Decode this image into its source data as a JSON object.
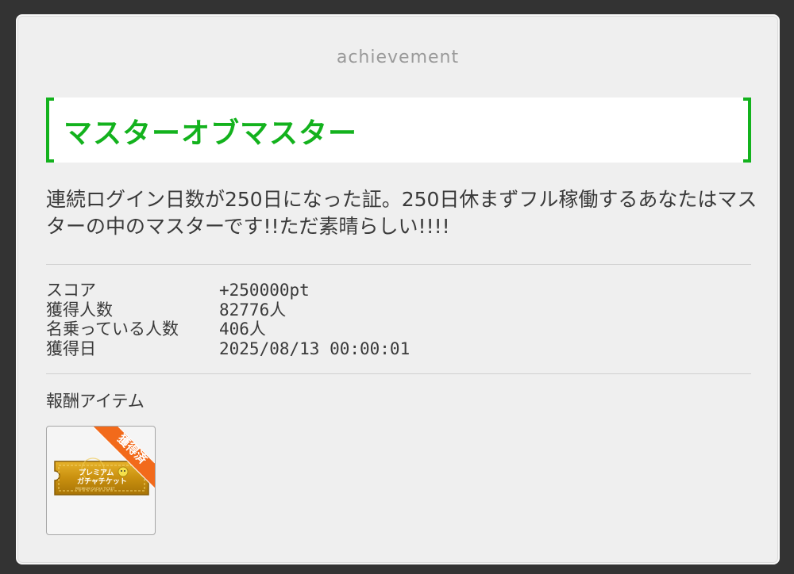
{
  "header": {
    "label": "achievement"
  },
  "achievement": {
    "title": "マスターオブマスター",
    "description": "連続ログイン日数が250日になった証。250日休まずフル稼働するあなたはマスターの中のマスターです!!ただ素晴らしい!!!!"
  },
  "stats": [
    {
      "label": "スコア",
      "value": "+250000pt"
    },
    {
      "label": "獲得人数",
      "value": "82776人"
    },
    {
      "label": "名乗っている人数",
      "value": "406人"
    },
    {
      "label": "獲得日",
      "value": "2025/08/13 00:00:01"
    }
  ],
  "rewards": {
    "heading": "報酬アイテム",
    "items": [
      {
        "name_line1": "プレミアム",
        "name_line2": "ガチャチケット",
        "subtext": "PREMIUM GACHA TICKET",
        "badge": "獲得済",
        "icon": "premium-gacha-ticket-icon",
        "badge_color": "#f26a1b"
      }
    ]
  },
  "colors": {
    "accent": "#13b21d",
    "panel": "#efefef",
    "background": "#333333"
  }
}
